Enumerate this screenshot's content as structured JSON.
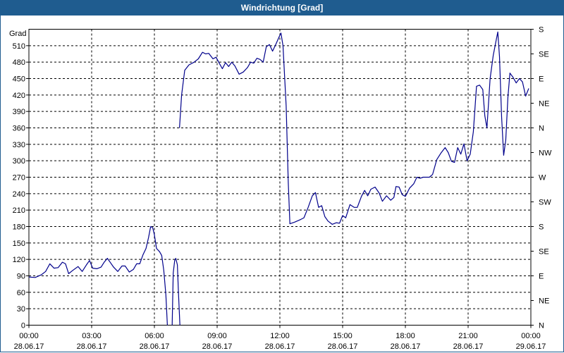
{
  "window": {
    "title": "Windrichtung [Grad]"
  },
  "chart_data": {
    "type": "line",
    "title": "Windrichtung [Grad]",
    "ylabel": "Grad",
    "ylim": [
      0,
      540
    ],
    "xlim": [
      "28.06.17 00:00",
      "29.06.17 00:00"
    ],
    "grid": true,
    "left_tick_labels": [
      "0",
      "30",
      "60",
      "90",
      "120",
      "150",
      "180",
      "210",
      "240",
      "270",
      "300",
      "330",
      "360",
      "390",
      "420",
      "450",
      "480",
      "510"
    ],
    "right_tick_values": [
      0,
      45,
      90,
      135,
      180,
      225,
      270,
      315,
      360,
      405,
      450,
      495,
      540
    ],
    "right_tick_labels": [
      "N",
      "NE",
      "E",
      "SE",
      "S",
      "SW",
      "W",
      "NW",
      "N",
      "NE",
      "E",
      "SE",
      "S"
    ],
    "x_tick_hours": [
      0,
      3,
      6,
      9,
      12,
      15,
      18,
      21,
      24
    ],
    "x_tick_times": [
      "00:00",
      "03:00",
      "06:00",
      "09:00",
      "12:00",
      "15:00",
      "18:00",
      "21:00",
      "00:00"
    ],
    "x_tick_dates": [
      "28.06.17",
      "28.06.17",
      "28.06.17",
      "28.06.17",
      "28.06.17",
      "28.06.17",
      "28.06.17",
      "28.06.17",
      "29.06.17"
    ],
    "line_color": "#00008b",
    "segments": [
      [
        [
          0.0,
          88
        ],
        [
          0.3,
          87
        ],
        [
          0.6,
          92
        ],
        [
          0.8,
          98
        ],
        [
          1.0,
          112
        ],
        [
          1.2,
          104
        ],
        [
          1.4,
          105
        ],
        [
          1.6,
          115
        ],
        [
          1.75,
          112
        ],
        [
          1.9,
          94
        ],
        [
          2.1,
          100
        ],
        [
          2.35,
          107
        ],
        [
          2.55,
          98
        ],
        [
          2.75,
          110
        ],
        [
          2.9,
          118
        ],
        [
          3.05,
          104
        ],
        [
          3.25,
          103
        ],
        [
          3.45,
          106
        ],
        [
          3.6,
          115
        ],
        [
          3.75,
          122
        ],
        [
          3.9,
          114
        ],
        [
          4.05,
          106
        ],
        [
          4.25,
          98
        ],
        [
          4.45,
          108
        ],
        [
          4.6,
          108
        ],
        [
          4.8,
          97
        ],
        [
          5.0,
          102
        ],
        [
          5.15,
          112
        ],
        [
          5.3,
          112
        ],
        [
          5.45,
          128
        ],
        [
          5.6,
          140
        ],
        [
          5.72,
          160
        ],
        [
          5.82,
          180
        ],
        [
          5.92,
          178
        ],
        [
          6.0,
          165
        ],
        [
          6.1,
          140
        ],
        [
          6.25,
          134
        ],
        [
          6.35,
          127
        ],
        [
          6.45,
          100
        ],
        [
          6.55,
          55
        ],
        [
          6.62,
          0
        ]
      ],
      [
        [
          6.85,
          0
        ],
        [
          6.9,
          95
        ],
        [
          6.97,
          118
        ],
        [
          7.02,
          122
        ],
        [
          7.1,
          110
        ],
        [
          7.15,
          60
        ],
        [
          7.22,
          0
        ]
      ],
      [
        [
          7.2,
          360
        ],
        [
          7.3,
          420
        ],
        [
          7.45,
          465
        ],
        [
          7.65,
          475
        ],
        [
          7.9,
          480
        ],
        [
          8.1,
          486
        ],
        [
          8.3,
          498
        ],
        [
          8.45,
          495
        ],
        [
          8.6,
          496
        ],
        [
          8.8,
          486
        ],
        [
          8.95,
          489
        ],
        [
          9.1,
          478
        ],
        [
          9.25,
          468
        ],
        [
          9.4,
          479
        ],
        [
          9.55,
          472
        ],
        [
          9.7,
          480
        ],
        [
          9.85,
          473
        ],
        [
          10.05,
          458
        ],
        [
          10.25,
          462
        ],
        [
          10.45,
          470
        ],
        [
          10.6,
          480
        ],
        [
          10.75,
          478
        ],
        [
          10.9,
          487
        ],
        [
          11.05,
          485
        ],
        [
          11.2,
          480
        ],
        [
          11.35,
          508
        ],
        [
          11.5,
          512
        ],
        [
          11.65,
          500
        ],
        [
          11.8,
          512
        ],
        [
          11.95,
          525
        ],
        [
          12.05,
          533
        ],
        [
          12.15,
          510
        ],
        [
          12.3,
          400
        ],
        [
          12.4,
          260
        ],
        [
          12.48,
          185
        ],
        [
          12.7,
          188
        ],
        [
          13.0,
          193
        ],
        [
          13.15,
          196
        ],
        [
          13.35,
          215
        ],
        [
          13.55,
          236
        ],
        [
          13.7,
          242
        ],
        [
          13.85,
          215
        ],
        [
          14.0,
          218
        ],
        [
          14.15,
          198
        ],
        [
          14.3,
          190
        ],
        [
          14.5,
          184
        ],
        [
          14.7,
          187
        ],
        [
          14.85,
          186
        ],
        [
          15.0,
          200
        ],
        [
          15.15,
          196
        ],
        [
          15.35,
          220
        ],
        [
          15.55,
          215
        ],
        [
          15.7,
          215
        ],
        [
          15.9,
          235
        ],
        [
          16.05,
          246
        ],
        [
          16.2,
          236
        ],
        [
          16.35,
          248
        ],
        [
          16.55,
          252
        ],
        [
          16.75,
          241
        ],
        [
          16.9,
          226
        ],
        [
          17.1,
          236
        ],
        [
          17.3,
          228
        ],
        [
          17.45,
          233
        ],
        [
          17.55,
          253
        ],
        [
          17.7,
          252
        ],
        [
          17.85,
          238
        ],
        [
          18.0,
          235
        ],
        [
          18.2,
          250
        ],
        [
          18.4,
          258
        ],
        [
          18.55,
          270
        ],
        [
          18.7,
          268
        ],
        [
          18.85,
          270
        ],
        [
          19.0,
          270
        ],
        [
          19.15,
          270
        ],
        [
          19.3,
          275
        ],
        [
          19.5,
          302
        ],
        [
          19.7,
          314
        ],
        [
          19.9,
          324
        ],
        [
          20.05,
          315
        ],
        [
          20.2,
          299
        ],
        [
          20.35,
          297
        ],
        [
          20.5,
          324
        ],
        [
          20.65,
          312
        ],
        [
          20.8,
          331
        ],
        [
          20.95,
          300
        ],
        [
          21.1,
          312
        ],
        [
          21.25,
          353
        ],
        [
          21.4,
          436
        ],
        [
          21.55,
          438
        ],
        [
          21.7,
          430
        ],
        [
          21.8,
          382
        ],
        [
          21.9,
          360
        ],
        [
          22.05,
          450
        ],
        [
          22.2,
          492
        ],
        [
          22.35,
          522
        ],
        [
          22.42,
          535
        ],
        [
          22.5,
          490
        ],
        [
          22.6,
          380
        ],
        [
          22.7,
          310
        ],
        [
          22.8,
          338
        ],
        [
          22.9,
          415
        ],
        [
          23.0,
          460
        ],
        [
          23.15,
          452
        ],
        [
          23.3,
          442
        ],
        [
          23.45,
          450
        ],
        [
          23.6,
          444
        ],
        [
          23.75,
          418
        ],
        [
          23.9,
          432
        ]
      ]
    ]
  }
}
